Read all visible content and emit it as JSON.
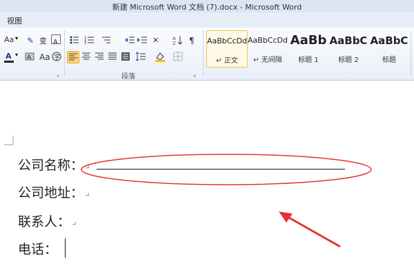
{
  "window": {
    "title": "新建 Microsoft Word 文档 (7).docx - Microsoft Word"
  },
  "menu": {
    "view_label": "视图"
  },
  "ribbon": {
    "paragraph_group_label": "段落",
    "font_size_label": "Aa",
    "font_color_label": "A",
    "styles": [
      {
        "sample": "AaBbCcDd",
        "name": "正文",
        "selected": true
      },
      {
        "sample": "AaBbCcDd",
        "name": "无间隔",
        "selected": false
      },
      {
        "sample": "AaBb",
        "name": "标题 1",
        "selected": false
      },
      {
        "sample": "AaBbC",
        "name": "标题 2",
        "selected": false
      },
      {
        "sample": "AaBbC",
        "name": "标题",
        "selected": false
      }
    ]
  },
  "document": {
    "company_name_label": "公司名称：",
    "company_address_label": "公司地址：",
    "contact_label": "联系人：",
    "phone_label": "电话：",
    "paragraph_mark": "↵"
  },
  "annotation": {
    "color": "#e8312f"
  }
}
